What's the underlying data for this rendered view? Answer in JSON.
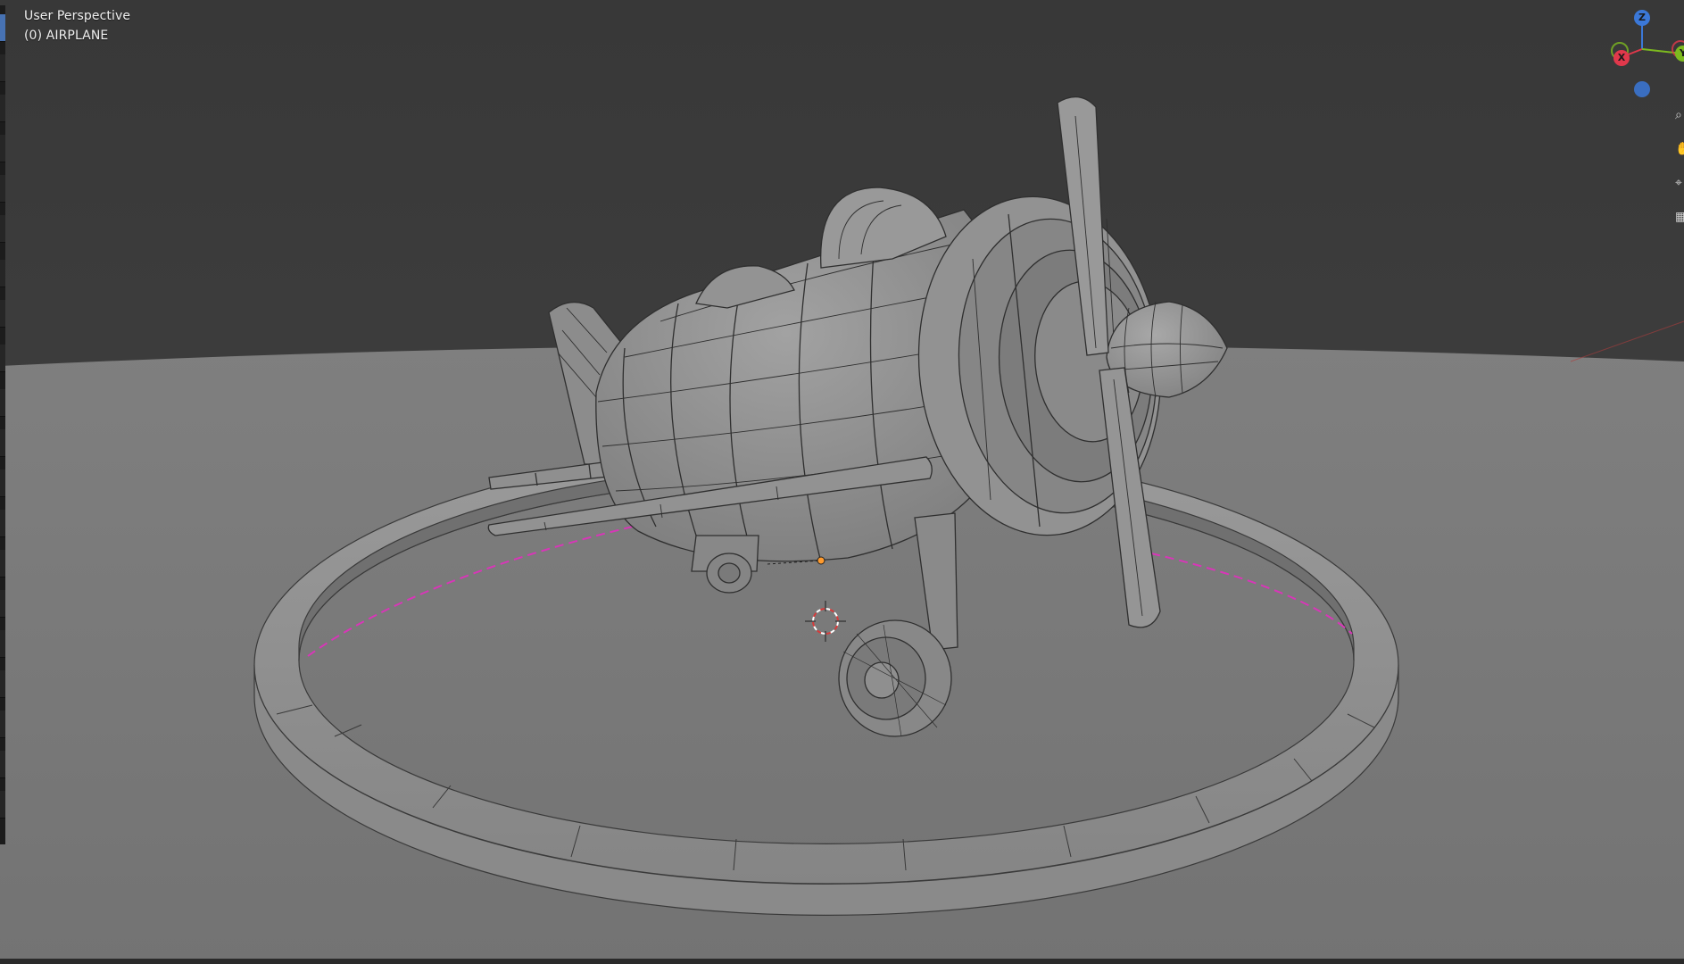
{
  "viewport": {
    "view_name": "User Perspective",
    "object_name": "(0) AIRPLANE"
  },
  "gizmo": {
    "axes": [
      {
        "name": "Z",
        "color": "#3b78d8"
      },
      {
        "name": "X",
        "color": "#e0384b"
      },
      {
        "name": "Y",
        "color": "#7dba1f"
      }
    ]
  },
  "scene": {
    "background_color": "#3a3a3a",
    "floor_color": "#7d7d7d",
    "mesh_color": "#8e8e8e",
    "wire_color": "#303030",
    "seam_color": "#d836b8"
  },
  "toolbar": {
    "active_tool_color": "#4772b3"
  },
  "right_tools": [
    "zoom-icon",
    "hand-icon",
    "camera-icon",
    "grid-icon"
  ]
}
